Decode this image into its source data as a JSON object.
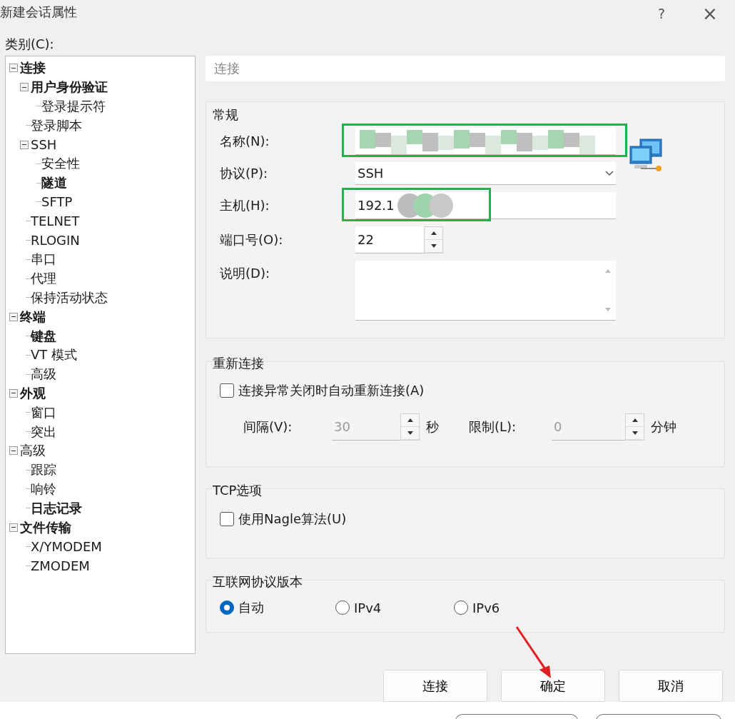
{
  "window": {
    "title": "新建会话属性",
    "help": "?",
    "close": "×"
  },
  "category_label": "类别(C):",
  "tree": [
    {
      "label": "连接",
      "bold": true,
      "expanded": true,
      "children": [
        {
          "label": "用户身份验证",
          "bold": true,
          "expanded": true,
          "children": [
            {
              "label": "登录提示符",
              "bold": false
            }
          ]
        },
        {
          "label": "登录脚本",
          "bold": false
        },
        {
          "label": "SSH",
          "bold": false,
          "expanded": true,
          "children": [
            {
              "label": "安全性",
              "bold": false
            },
            {
              "label": "隧道",
              "bold": true
            },
            {
              "label": "SFTP",
              "bold": false
            }
          ]
        },
        {
          "label": "TELNET",
          "bold": false
        },
        {
          "label": "RLOGIN",
          "bold": false
        },
        {
          "label": "串口",
          "bold": false
        },
        {
          "label": "代理",
          "bold": false
        },
        {
          "label": "保持活动状态",
          "bold": false
        }
      ]
    },
    {
      "label": "终端",
      "bold": true,
      "expanded": true,
      "children": [
        {
          "label": "键盘",
          "bold": true
        },
        {
          "label": "VT 模式",
          "bold": false
        },
        {
          "label": "高级",
          "bold": false
        }
      ]
    },
    {
      "label": "外观",
      "bold": true,
      "expanded": true,
      "children": [
        {
          "label": "窗口",
          "bold": false
        },
        {
          "label": "突出",
          "bold": false
        }
      ]
    },
    {
      "label": "高级",
      "bold": false,
      "expanded": true,
      "children": [
        {
          "label": "跟踪",
          "bold": false
        },
        {
          "label": "响铃",
          "bold": false
        },
        {
          "label": "日志记录",
          "bold": true
        }
      ]
    },
    {
      "label": "文件传输",
      "bold": true,
      "expanded": true,
      "children": [
        {
          "label": "X/YMODEM",
          "bold": false
        },
        {
          "label": "ZMODEM",
          "bold": false
        }
      ]
    }
  ],
  "header": "连接",
  "general": {
    "title": "常规",
    "name": {
      "label": "名称(N):",
      "redacted": true,
      "highlighted": true
    },
    "protocol": {
      "label": "协议(P):",
      "value": "SSH"
    },
    "host": {
      "label": "主机(H):",
      "value": "192.1",
      "redacted": true,
      "highlighted": true
    },
    "port": {
      "label": "端口号(O):",
      "value": "22"
    },
    "description": {
      "label": "说明(D):"
    }
  },
  "reconnect": {
    "title": "重新连接",
    "checkbox": {
      "label": "连接异常关闭时自动重新连接(A)",
      "checked": false
    },
    "interval": {
      "label": "间隔(V):",
      "value": "30",
      "unit": "秒",
      "disabled": true
    },
    "limit": {
      "label": "限制(L):",
      "value": "0",
      "unit": "分钟",
      "disabled": true
    }
  },
  "tcp": {
    "title": "TCP选项",
    "checkbox": {
      "label": "使用Nagle算法(U)",
      "checked": false
    }
  },
  "ip_version": {
    "title": "互联网协议版本",
    "options": [
      {
        "label": "自动",
        "selected": true
      },
      {
        "label": "IPv4",
        "selected": false
      },
      {
        "label": "IPv6",
        "selected": false
      }
    ]
  },
  "buttons": [
    "连接",
    "确定",
    "取消"
  ]
}
